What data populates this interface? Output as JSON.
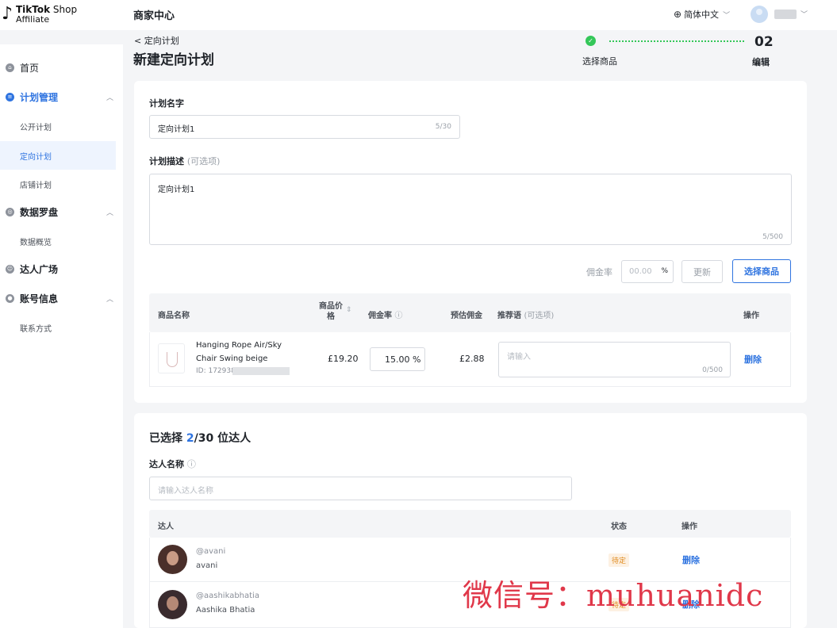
{
  "topbar": {
    "logo_line1_bold": "TikTok",
    "logo_line1_rest": " Shop",
    "logo_line2": "Affiliate",
    "app_title": "商家中心",
    "language": "简体中文"
  },
  "sidebar": {
    "home": "首页",
    "plan_mgmt": "计划管理",
    "public_plan": "公开计划",
    "targeted_plan": "定向计划",
    "shop_plan": "店铺计划",
    "data_compass": "数据罗盘",
    "data_overview": "数据概览",
    "creator_plaza": "达人广场",
    "account_info": "账号信息",
    "contact": "联系方式"
  },
  "header": {
    "back": "< 定向计划",
    "title": "新建定向计划",
    "step1_check": "✓",
    "step1_label": "选择商品",
    "step2_num": "02",
    "step2_label": "编辑"
  },
  "form": {
    "plan_name_label": "计划名字",
    "plan_name_value": "定向计划1",
    "plan_name_count": "5/30",
    "desc_label": "计划描述",
    "desc_optional": "(可选项)",
    "desc_value": "定向计划1",
    "desc_count": "5/500",
    "commission_label": "佣金率",
    "commission_placeholder": "00.00",
    "commission_unit": "%",
    "update_button": "更新",
    "select_products_button": "选择商品"
  },
  "product_table": {
    "headers": {
      "name": "商品名称",
      "price_l1": "商品价",
      "price_l2": "格",
      "commission": "佣金率",
      "est_commission": "预估佣金",
      "recommend": "推荐语",
      "recommend_opt": "(可选项)",
      "action": "操作"
    },
    "rows": [
      {
        "name": "Hanging Rope Air/Sky Chair Swing beige",
        "id": "ID: 172938",
        "price": "£19.20",
        "commission": "15.00 %",
        "est": "£2.88",
        "recommend_placeholder": "请输入",
        "recommend_count": "0/500",
        "action": "删除"
      }
    ]
  },
  "creators": {
    "title_prefix": "已选择 ",
    "selected": "2",
    "title_suffix": "/30 位达人",
    "name_label": "达人名称",
    "search_placeholder": "请输入达人名称",
    "headers": {
      "creator": "达人",
      "status": "状态",
      "action": "操作"
    },
    "rows": [
      {
        "handle": "@avani",
        "name": "avani",
        "status": "待定",
        "action": "删除"
      },
      {
        "handle": "@aashikabhatia",
        "name": "Aashika Bhatia",
        "status": "待定",
        "action": "删除"
      }
    ]
  },
  "watermark": "微信号：muhuanidc",
  "colors": {
    "accent": "#2f74e0",
    "success": "#34c759",
    "pending": "#e08a1e",
    "watermark": "#e0384a"
  }
}
